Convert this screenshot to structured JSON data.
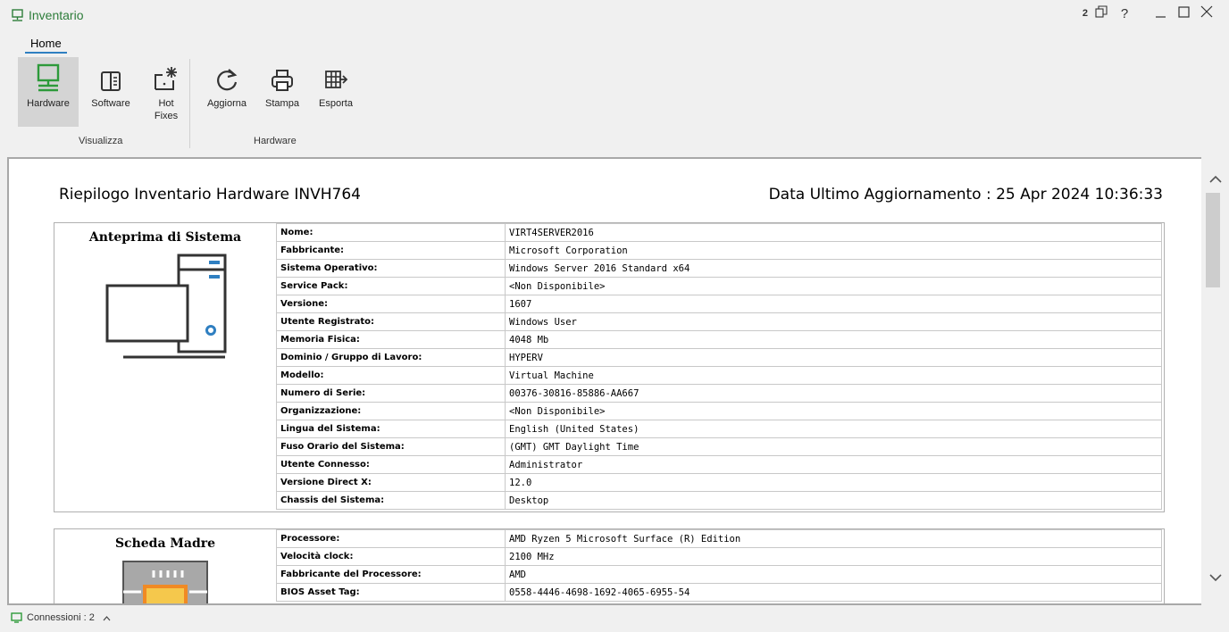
{
  "app": {
    "title": "Inventario",
    "session_count": "2",
    "help": "?"
  },
  "ribbon": {
    "tab": "Home",
    "buttons": {
      "hardware": "Hardware",
      "software": "Software",
      "hotfixes_1": "Hot",
      "hotfixes_2": "Fixes",
      "refresh": "Aggiorna",
      "print": "Stampa",
      "export": "Esporta"
    },
    "groups": {
      "view": "Visualizza",
      "hardware": "Hardware"
    }
  },
  "report": {
    "title": "Riepilogo Inventario Hardware INVH764",
    "date": "Data Ultimo Aggiornamento : 25 Apr 2024 10:36:33",
    "system": {
      "title": "Anteprima di Sistema",
      "rows": [
        {
          "k": "Nome:",
          "v": "VIRT4SERVER2016"
        },
        {
          "k": "Fabbricante:",
          "v": "Microsoft Corporation"
        },
        {
          "k": "Sistema Operativo:",
          "v": "Windows Server 2016 Standard x64"
        },
        {
          "k": "Service Pack:",
          "v": "<Non Disponibile>"
        },
        {
          "k": "Versione:",
          "v": "1607"
        },
        {
          "k": "Utente Registrato:",
          "v": "Windows User"
        },
        {
          "k": "Memoria Fisica:",
          "v": "4048 Mb"
        },
        {
          "k": "Dominio / Gruppo di Lavoro:",
          "v": "HYPERV"
        },
        {
          "k": "Modello:",
          "v": "Virtual Machine"
        },
        {
          "k": "Numero di Serie:",
          "v": "00376-30816-85886-AA667"
        },
        {
          "k": "Organizzazione:",
          "v": "<Non Disponibile>"
        },
        {
          "k": "Lingua del Sistema:",
          "v": "English (United States)"
        },
        {
          "k": "Fuso Orario del Sistema:",
          "v": "(GMT) GMT Daylight Time"
        },
        {
          "k": "Utente Connesso:",
          "v": "Administrator"
        },
        {
          "k": "Versione Direct X:",
          "v": "12.0"
        },
        {
          "k": "Chassis del Sistema:",
          "v": "Desktop"
        }
      ]
    },
    "motherboard": {
      "title": "Scheda Madre",
      "rows": [
        {
          "k": "Processore:",
          "v": "AMD Ryzen 5 Microsoft Surface (R) Edition"
        },
        {
          "k": "Velocità clock:",
          "v": "2100 MHz"
        },
        {
          "k": "Fabbricante del Processore:",
          "v": "AMD"
        },
        {
          "k": "BIOS Asset Tag:",
          "v": "0558-4446-4698-1692-4065-6955-54"
        }
      ]
    }
  },
  "status": {
    "connections": "Connessioni : 2"
  },
  "colors": {
    "accent": "#2f7fc1",
    "brand_green": "#2d7d3a",
    "cpu_orange": "#f08a24"
  }
}
